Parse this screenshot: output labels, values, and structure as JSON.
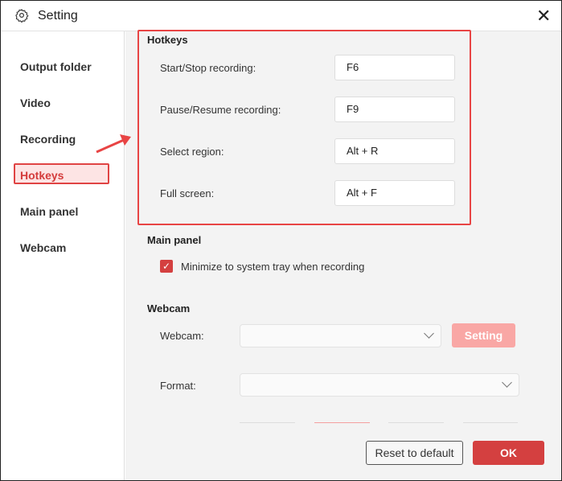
{
  "window": {
    "title": "Setting"
  },
  "sidebar": {
    "items": [
      {
        "label": "Output folder"
      },
      {
        "label": "Video"
      },
      {
        "label": "Recording"
      },
      {
        "label": "Hotkeys"
      },
      {
        "label": "Main panel"
      },
      {
        "label": "Webcam"
      }
    ],
    "active": "Hotkeys"
  },
  "hotkeys": {
    "heading": "Hotkeys",
    "rows": [
      {
        "label": "Start/Stop recording:",
        "value": "F6"
      },
      {
        "label": "Pause/Resume recording:",
        "value": "F9"
      },
      {
        "label": "Select region:",
        "value": "Alt + R"
      },
      {
        "label": "Full screen:",
        "value": "Alt + F"
      }
    ]
  },
  "main_panel": {
    "heading": "Main panel",
    "checkbox_label": "Minimize to system tray when recording",
    "checked": true
  },
  "webcam": {
    "heading": "Webcam",
    "webcam_label": "Webcam:",
    "webcam_value": "",
    "setting_button": "Setting",
    "format_label": "Format:",
    "format_value": ""
  },
  "footer": {
    "reset": "Reset to default",
    "ok": "OK"
  },
  "colors": {
    "accent": "#d44040",
    "highlight": "#e84444"
  }
}
